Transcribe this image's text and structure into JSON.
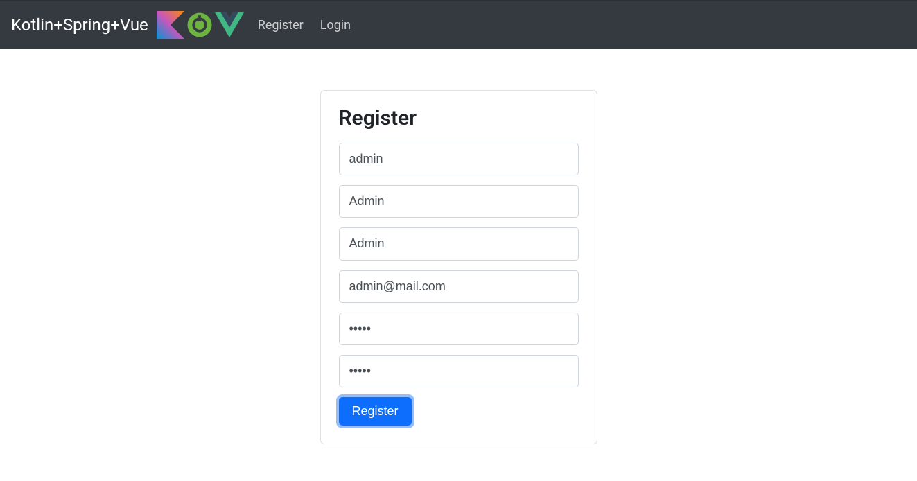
{
  "navbar": {
    "brand": "Kotlin+Spring+Vue",
    "links": {
      "register": "Register",
      "login": "Login"
    }
  },
  "form": {
    "title": "Register",
    "fields": {
      "username": "admin",
      "firstName": "Admin",
      "lastName": "Admin",
      "email": "admin@mail.com",
      "password": "admin",
      "confirmPassword": "admin"
    },
    "submit": "Register"
  }
}
